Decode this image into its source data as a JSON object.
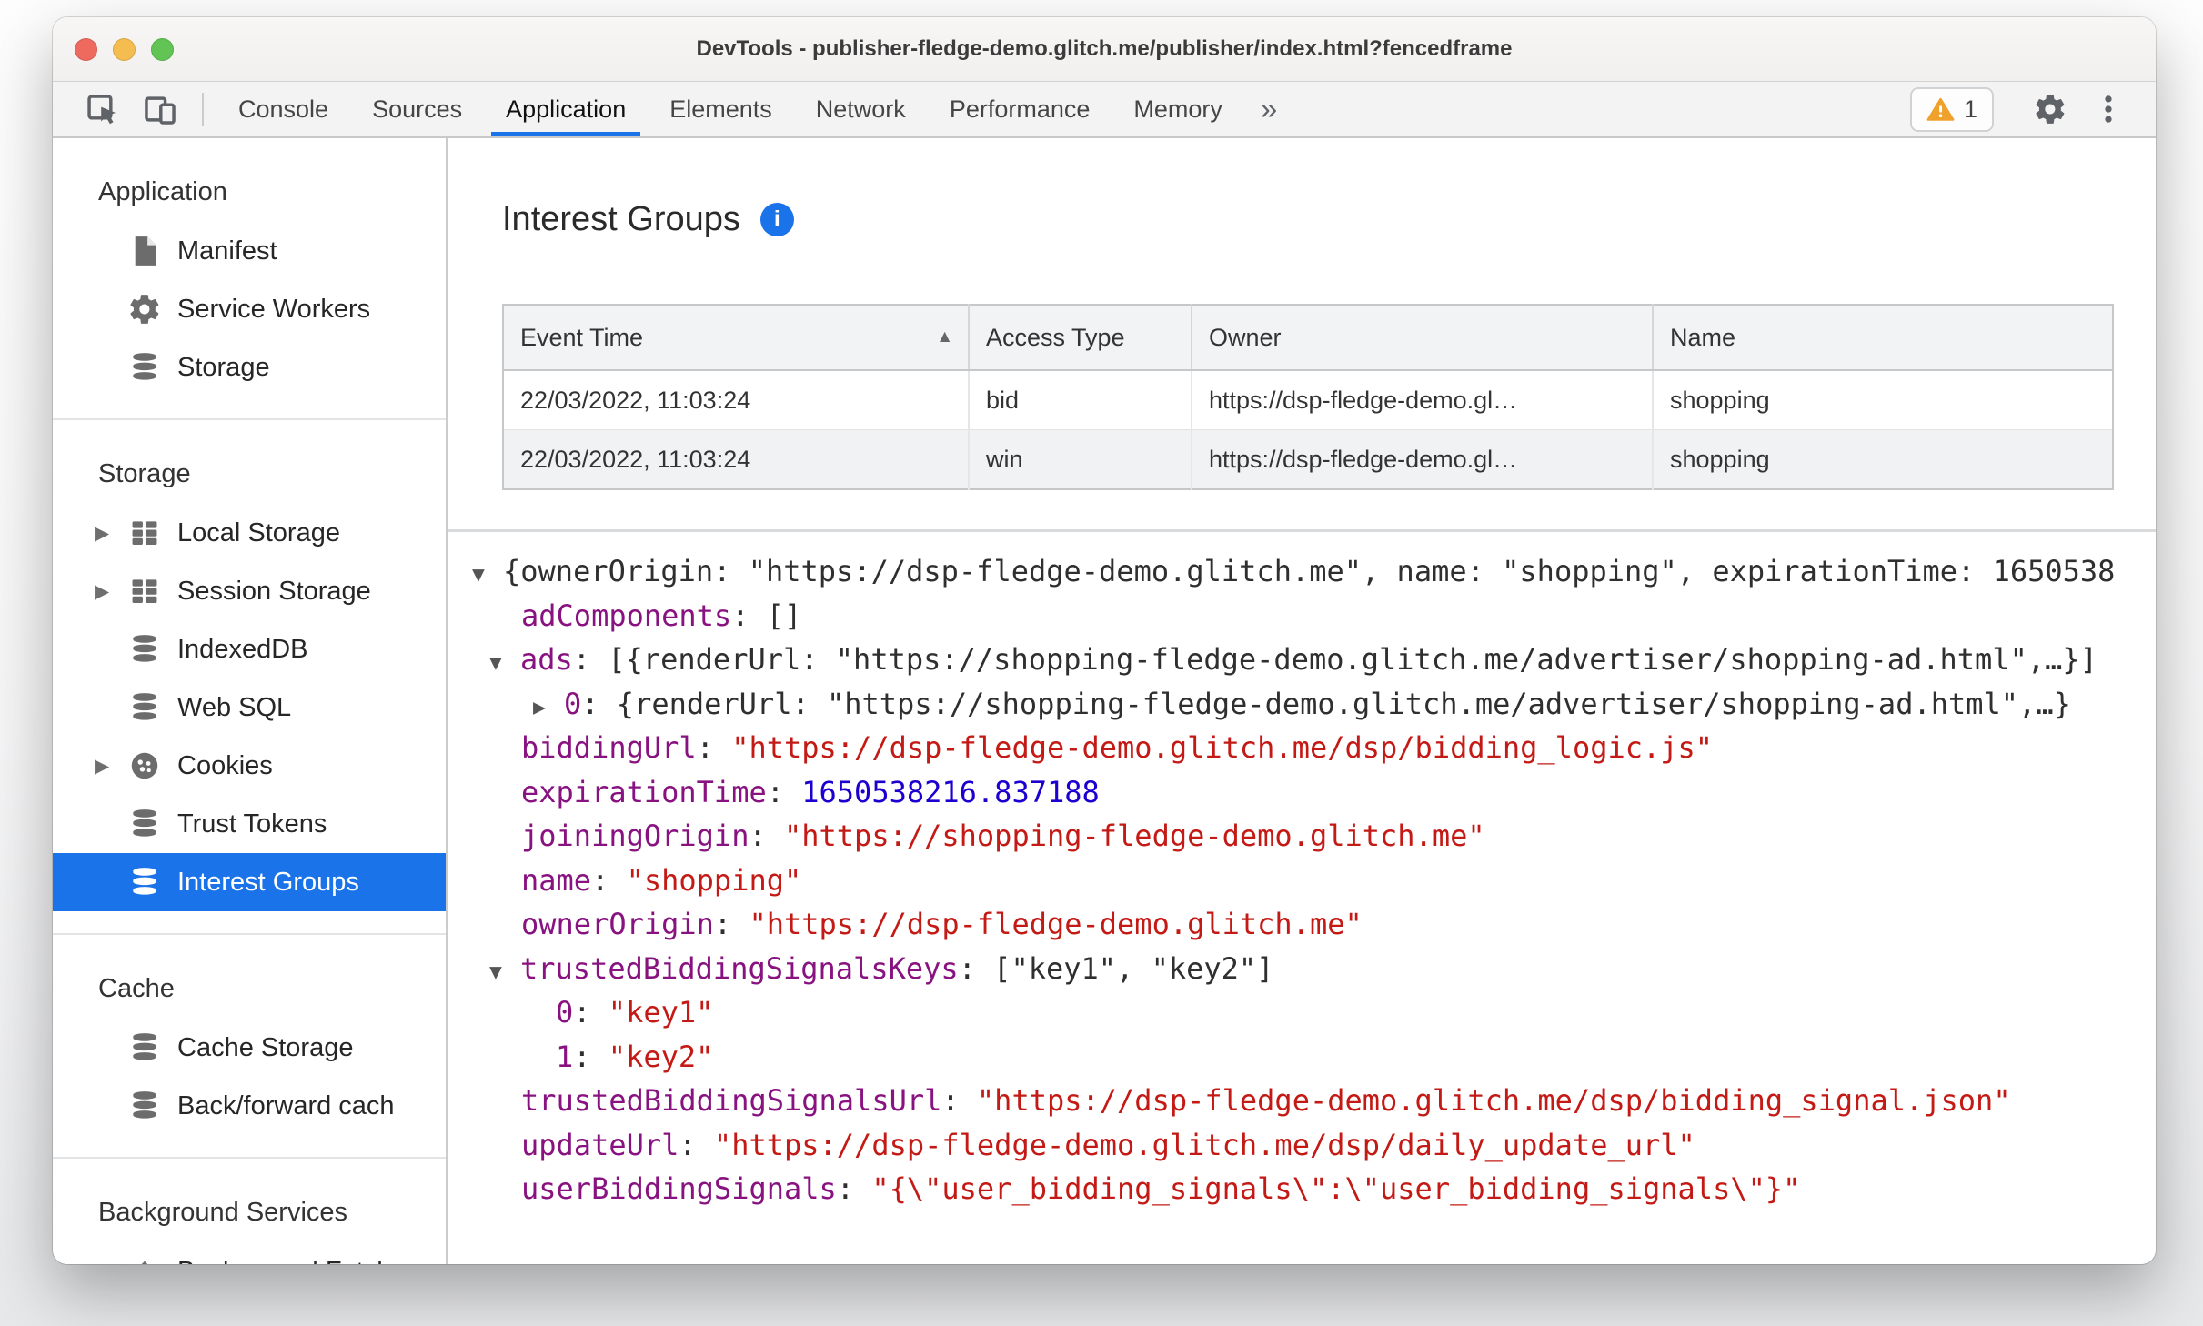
{
  "window": {
    "title": "DevTools - publisher-fledge-demo.glitch.me/publisher/index.html?fencedframe"
  },
  "colors": {
    "accent": "#1a73e8",
    "key_purple": "#881280",
    "string_red": "#c41a16",
    "number_blue": "#1c00cf",
    "warning_amber": "#f0a12c"
  },
  "toolbar": {
    "tabs": [
      {
        "label": "Console"
      },
      {
        "label": "Sources"
      },
      {
        "label": "Application",
        "selected": true
      },
      {
        "label": "Elements"
      },
      {
        "label": "Network"
      },
      {
        "label": "Performance"
      },
      {
        "label": "Memory"
      }
    ],
    "more_tabs_glyph": "»",
    "warning_count": "1"
  },
  "sidebar": {
    "sections": [
      {
        "header": "Application",
        "items": [
          {
            "label": "Manifest",
            "icon": "file-icon"
          },
          {
            "label": "Service Workers",
            "icon": "gear-icon"
          },
          {
            "label": "Storage",
            "icon": "database-icon"
          }
        ]
      },
      {
        "header": "Storage",
        "items": [
          {
            "label": "Local Storage",
            "icon": "table-icon",
            "expandable": true
          },
          {
            "label": "Session Storage",
            "icon": "table-icon",
            "expandable": true
          },
          {
            "label": "IndexedDB",
            "icon": "database-icon"
          },
          {
            "label": "Web SQL",
            "icon": "database-icon"
          },
          {
            "label": "Cookies",
            "icon": "cookie-icon",
            "expandable": true
          },
          {
            "label": "Trust Tokens",
            "icon": "database-icon"
          },
          {
            "label": "Interest Groups",
            "icon": "database-icon",
            "selected": true
          }
        ]
      },
      {
        "header": "Cache",
        "items": [
          {
            "label": "Cache Storage",
            "icon": "database-icon"
          },
          {
            "label": "Back/forward cach",
            "icon": "database-icon"
          }
        ]
      },
      {
        "header": "Background Services",
        "items": [
          {
            "label": "Background Fetch",
            "icon": "upload-icon"
          }
        ]
      }
    ]
  },
  "main": {
    "title": "Interest Groups",
    "table": {
      "columns": [
        {
          "label": "Event Time",
          "sort": "asc"
        },
        {
          "label": "Access Type"
        },
        {
          "label": "Owner"
        },
        {
          "label": "Name"
        }
      ],
      "rows": [
        [
          "22/03/2022, 11:03:24",
          "bid",
          "https://dsp-fledge-demo.gl…",
          "shopping"
        ],
        [
          "22/03/2022, 11:03:24",
          "win",
          "https://dsp-fledge-demo.gl…",
          "shopping"
        ]
      ]
    },
    "tree": {
      "lines": [
        {
          "pad": 0,
          "arrow": "▼",
          "segs": [
            [
              "p",
              "{ownerOrigin: \"https://dsp-fledge-demo.glitch.me\", name: \"shopping\", expirationTime: 1650538"
            ]
          ]
        },
        {
          "pad": 54,
          "arrow": "",
          "segs": [
            [
              "k",
              "adComponents"
            ],
            [
              "p",
              ": []"
            ]
          ]
        },
        {
          "pad": 19,
          "arrow": "▼",
          "segs": [
            [
              "k",
              "ads"
            ],
            [
              "p",
              ": [{renderUrl: \"https://shopping-fledge-demo.glitch.me/advertiser/shopping-ad.html\",…}]"
            ]
          ]
        },
        {
          "pad": 67,
          "arrow": "▶",
          "segs": [
            [
              "k",
              "0"
            ],
            [
              "p",
              ": {renderUrl: \"https://shopping-fledge-demo.glitch.me/advertiser/shopping-ad.html\",…}"
            ]
          ]
        },
        {
          "pad": 54,
          "arrow": "",
          "segs": [
            [
              "k",
              "biddingUrl"
            ],
            [
              "p",
              ": "
            ],
            [
              "s",
              "\"https://dsp-fledge-demo.glitch.me/dsp/bidding_logic.js\""
            ]
          ]
        },
        {
          "pad": 54,
          "arrow": "",
          "segs": [
            [
              "k",
              "expirationTime"
            ],
            [
              "p",
              ": "
            ],
            [
              "n",
              "1650538216.837188"
            ]
          ]
        },
        {
          "pad": 54,
          "arrow": "",
          "segs": [
            [
              "k",
              "joiningOrigin"
            ],
            [
              "p",
              ": "
            ],
            [
              "s",
              "\"https://shopping-fledge-demo.glitch.me\""
            ]
          ]
        },
        {
          "pad": 54,
          "arrow": "",
          "segs": [
            [
              "k",
              "name"
            ],
            [
              "p",
              ": "
            ],
            [
              "s",
              "\"shopping\""
            ]
          ]
        },
        {
          "pad": 54,
          "arrow": "",
          "segs": [
            [
              "k",
              "ownerOrigin"
            ],
            [
              "p",
              ": "
            ],
            [
              "s",
              "\"https://dsp-fledge-demo.glitch.me\""
            ]
          ]
        },
        {
          "pad": 19,
          "arrow": "▼",
          "segs": [
            [
              "k",
              "trustedBiddingSignalsKeys"
            ],
            [
              "p",
              ": [\"key1\", \"key2\"]"
            ]
          ]
        },
        {
          "pad": 92,
          "arrow": "",
          "segs": [
            [
              "k",
              "0"
            ],
            [
              "p",
              ": "
            ],
            [
              "s",
              "\"key1\""
            ]
          ]
        },
        {
          "pad": 92,
          "arrow": "",
          "segs": [
            [
              "k",
              "1"
            ],
            [
              "p",
              ": "
            ],
            [
              "s",
              "\"key2\""
            ]
          ]
        },
        {
          "pad": 54,
          "arrow": "",
          "segs": [
            [
              "k",
              "trustedBiddingSignalsUrl"
            ],
            [
              "p",
              ": "
            ],
            [
              "s",
              "\"https://dsp-fledge-demo.glitch.me/dsp/bidding_signal.json\""
            ]
          ]
        },
        {
          "pad": 54,
          "arrow": "",
          "segs": [
            [
              "k",
              "updateUrl"
            ],
            [
              "p",
              ": "
            ],
            [
              "s",
              "\"https://dsp-fledge-demo.glitch.me/dsp/daily_update_url\""
            ]
          ]
        },
        {
          "pad": 54,
          "arrow": "",
          "segs": [
            [
              "k",
              "userBiddingSignals"
            ],
            [
              "p",
              ": "
            ],
            [
              "s",
              "\"{\\\"user_bidding_signals\\\":\\\"user_bidding_signals\\\"}\""
            ]
          ]
        }
      ]
    }
  }
}
